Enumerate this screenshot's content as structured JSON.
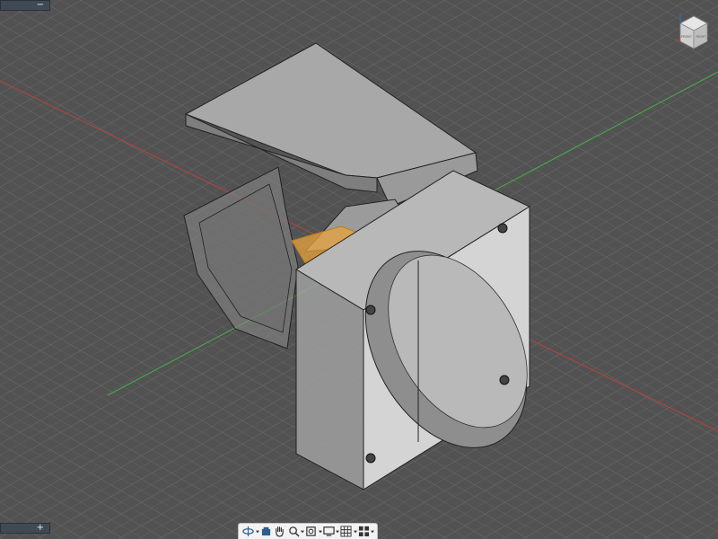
{
  "panels": {
    "top_tab_symbol": "−",
    "bottom_tab_symbol": "+"
  },
  "colors": {
    "viewport_bg": "#525252",
    "grid_line": "#7a7a7a",
    "axis_x": "#c0392b",
    "axis_y": "#2ecc40",
    "model_top": "#b5b5b5",
    "model_side": "#8c8c8c",
    "selection_face": "#e8a33d"
  },
  "viewcube": {
    "icon": "viewcube-icon",
    "front_label": "FRONT",
    "right_label": "RIGHT"
  },
  "nav_bar": {
    "items": [
      {
        "name": "orbit",
        "icon": "orbit-icon",
        "has_menu": true
      },
      {
        "name": "look-at",
        "icon": "look-at-icon",
        "has_menu": false
      },
      {
        "name": "pan",
        "icon": "pan-hand-icon",
        "has_menu": false
      },
      {
        "name": "zoom",
        "icon": "zoom-icon",
        "has_menu": true
      },
      {
        "name": "fit",
        "icon": "fit-icon",
        "has_menu": true
      },
      {
        "name": "display-settings",
        "icon": "display-settings-icon",
        "has_menu": true
      },
      {
        "name": "grid-settings",
        "icon": "grid-icon",
        "has_menu": true
      },
      {
        "name": "viewports",
        "icon": "viewports-icon",
        "has_menu": true
      }
    ]
  }
}
